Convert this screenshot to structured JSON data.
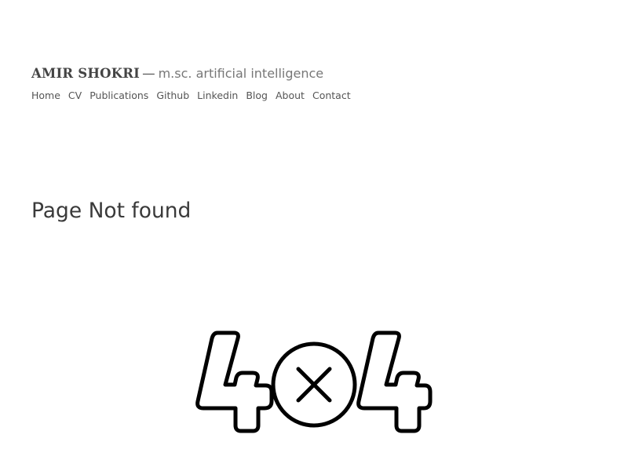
{
  "site": {
    "name": "AMIR SHOKRI",
    "separator": "—",
    "tagline": "m.sc. artificial intelligence"
  },
  "nav": {
    "items": [
      {
        "label": "Home"
      },
      {
        "label": "CV"
      },
      {
        "label": "Publications"
      },
      {
        "label": "Github"
      },
      {
        "label": "Linkedin"
      },
      {
        "label": "Blog"
      },
      {
        "label": "About"
      },
      {
        "label": "Contact"
      }
    ]
  },
  "page": {
    "title": "Page Not found"
  },
  "illustration": {
    "icon": "404-icon",
    "color": "#000000"
  }
}
